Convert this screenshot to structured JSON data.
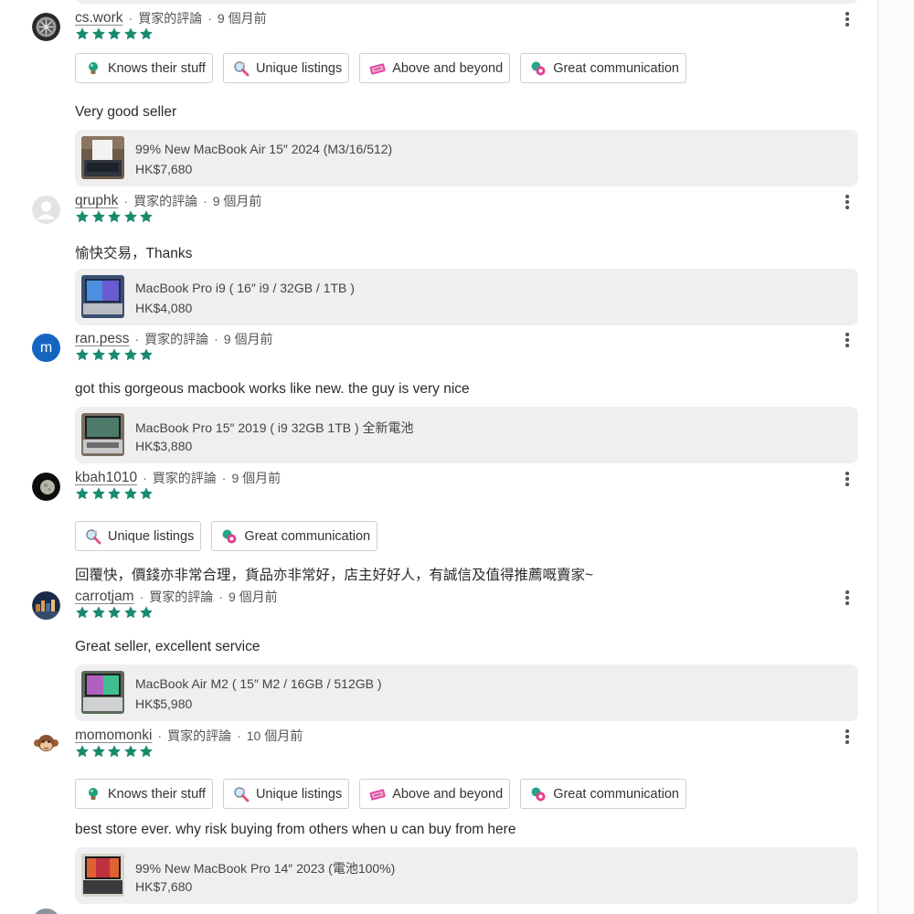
{
  "reviews": [
    {
      "username": "cs.work",
      "role": "買家的評論",
      "time": "9 個月前",
      "avatar": "wheel-avatar",
      "rating": 5,
      "tags": [
        "Knows their stuff",
        "Unique listings",
        "Above and beyond",
        "Great communication"
      ],
      "comment": "Very good seller",
      "listing": {
        "title": "99% New MacBook Air 15″ 2024 (M3/16/512)",
        "price": "HK$7,680"
      }
    },
    {
      "username": "qruphk",
      "role": "買家的評論",
      "time": "9 個月前",
      "avatar": "default-avatar",
      "rating": 5,
      "tags": [],
      "comment": "愉快交易，Thanks",
      "listing": {
        "title": "MacBook Pro i9 ( 16″ i9 / 32GB / 1TB )",
        "price": "HK$4,080"
      }
    },
    {
      "username": "ran.pess",
      "role": "買家的評論",
      "time": "9 個月前",
      "avatar": "m",
      "rating": 5,
      "tags": [],
      "comment": "got this gorgeous macbook works like new. the guy is very nice",
      "listing": {
        "title": "MacBook Pro 15″ 2019 ( i9 32GB 1TB ) 全新電池",
        "price": "HK$3,880"
      }
    },
    {
      "username": "kbah1010",
      "role": "買家的評論",
      "time": "9 個月前",
      "avatar": "moon-avatar",
      "rating": 5,
      "tags": [
        "Unique listings",
        "Great communication"
      ],
      "comment": "回覆快，價錢亦非常合理，貨品亦非常好，店主好好人，有誠信及值得推薦嘅賣家~",
      "listing": null
    },
    {
      "username": "carrotjam",
      "role": "買家的評論",
      "time": "9 個月前",
      "avatar": "city-avatar",
      "rating": 5,
      "tags": [],
      "comment": "Great seller, excellent service",
      "listing": {
        "title": "MacBook Air M2 ( 15″ M2 / 16GB / 512GB )",
        "price": "HK$5,980"
      }
    },
    {
      "username": "momomonki",
      "role": "買家的評論",
      "time": "10 個月前",
      "avatar": "monkey-avatar",
      "rating": 5,
      "tags": [
        "Knows their stuff",
        "Unique listings",
        "Above and beyond",
        "Great communication"
      ],
      "comment": "best store ever. why risk buying from others when u can buy from here",
      "listing": {
        "title": "99% New MacBook Pro 14″ 2023 (電池100%)",
        "price": "HK$7,680"
      }
    }
  ],
  "tag_icons": {
    "Knows their stuff": "lightbulb-icon",
    "Unique listings": "magnifier-icon",
    "Above and beyond": "ticket-icon",
    "Great communication": "chat-bubbles-icon"
  },
  "colors": {
    "star": "#1a8a6e",
    "avatar_letter_bg": "#1565c0",
    "listing_bg": "#efefef"
  }
}
